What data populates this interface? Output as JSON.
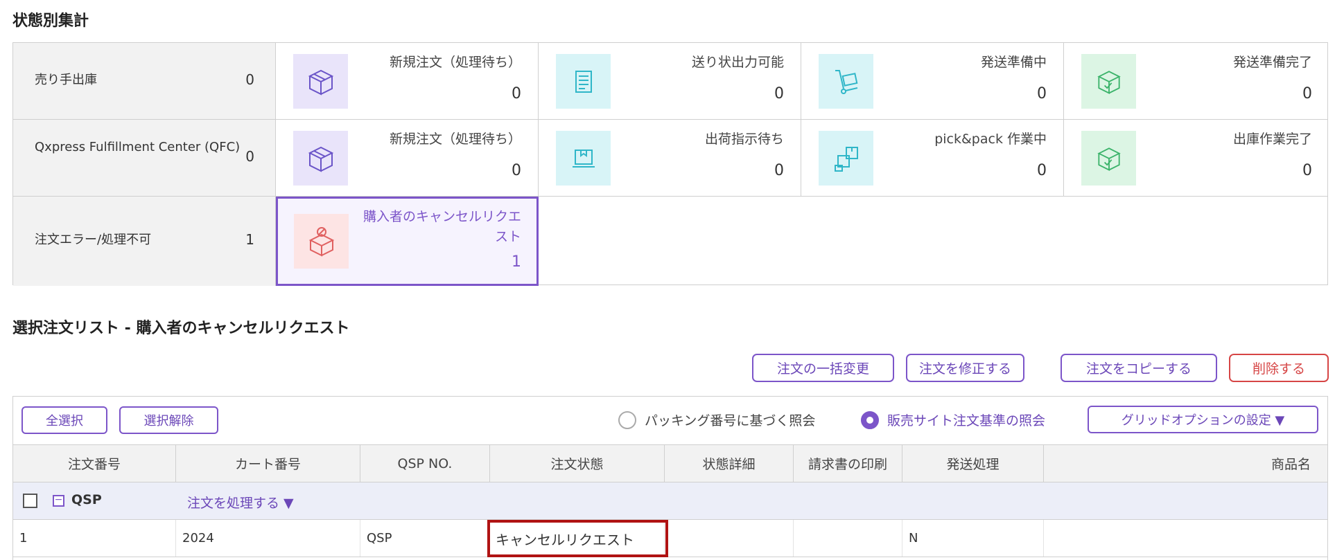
{
  "summary_title": "状態別集計",
  "rows": [
    {
      "label": "売り手出庫",
      "count": "0",
      "cells": [
        {
          "label": "新規注文（処理待ち）",
          "value": "0",
          "icon": "box-open-icon",
          "color": "purple"
        },
        {
          "label": "送り状出力可能",
          "value": "0",
          "icon": "invoice-icon",
          "color": "cyan"
        },
        {
          "label": "発送準備中",
          "value": "0",
          "icon": "hand-truck-icon",
          "color": "cyan"
        },
        {
          "label": "発送準備完了",
          "value": "0",
          "icon": "box-check-icon",
          "color": "green"
        }
      ]
    },
    {
      "label": "Qxpress Fulfillment Center (QFC)",
      "count": "0",
      "cells": [
        {
          "label": "新規注文（処理待ち）",
          "value": "0",
          "icon": "box-open-icon",
          "color": "purple"
        },
        {
          "label": "出荷指示待ち",
          "value": "0",
          "icon": "monitor-icon",
          "color": "cyan"
        },
        {
          "label": "pick&pack 作業中",
          "value": "0",
          "icon": "boxes-icon",
          "color": "cyan"
        },
        {
          "label": "出庫作業完了",
          "value": "0",
          "icon": "box-check-icon",
          "color": "green"
        }
      ]
    },
    {
      "label": "注文エラー/処理不可",
      "count": "1",
      "cells": [
        {
          "label": "購入者のキャンセルリクエスト",
          "value": "1",
          "icon": "box-cancel-icon",
          "color": "red",
          "selected": true
        }
      ]
    }
  ],
  "list_title": "選択注文リスト - 購入者のキャンセルリクエスト",
  "actions": {
    "bulk_change": "注文の一括変更",
    "edit": "注文を修正する",
    "copy": "注文をコピーする",
    "delete": "削除する"
  },
  "grid": {
    "select_all": "全選択",
    "deselect": "選択解除",
    "radio_packing": "パッキング番号に基づく照会",
    "radio_site": "販売サイト注文基準の照会",
    "grid_options": "グリッドオプションの設定 ▼",
    "columns": [
      "注文番号",
      "カート番号",
      "QSP NO.",
      "注文状態",
      "状態詳細",
      "請求書の印刷",
      "発送処理",
      "商品名"
    ],
    "group_label": "QSP",
    "group_action": "注文を処理する ▼",
    "rows": [
      {
        "order_no": "1",
        "cart_no": "2024",
        "qsp_no": "QSP",
        "status": "キャンセルリクエスト",
        "status_detail": "",
        "invoice": "",
        "shipping": "N",
        "product": ""
      }
    ]
  }
}
